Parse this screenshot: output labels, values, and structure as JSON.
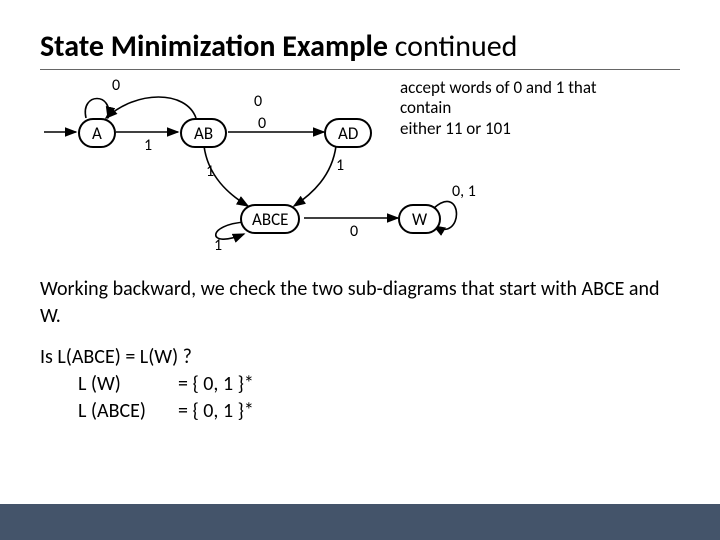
{
  "title": {
    "main": "State Minimization Example",
    "cont": " continued"
  },
  "accept_text_l1": "accept words of 0 and 1 that contain",
  "accept_text_l2": "either 11 or 101",
  "states": {
    "A": "A",
    "AB": "AB",
    "AD": "AD",
    "ABCE": "ABCE",
    "W": "W"
  },
  "edges": {
    "a_self_0": "0",
    "a_ab_1": "1",
    "ab_top_0": "0",
    "ab_ad_0": "0",
    "ab_abce_1": "1",
    "abce_self_1": "1",
    "ad_abce_1": "1",
    "abce_w_0": "0",
    "w_self_01": "0, 1"
  },
  "body_p1": "Working backward, we check the two sub-diagrams that start with ABCE and W.",
  "q_line": "Is L(ABCE) = L(W) ?",
  "eq_lw_lhs": "L (W)",
  "eq_lw_rhs": "= { 0, 1 }*",
  "eq_labce_lhs": "L (ABCE)",
  "eq_labce_rhs": "= { 0, 1 }*"
}
